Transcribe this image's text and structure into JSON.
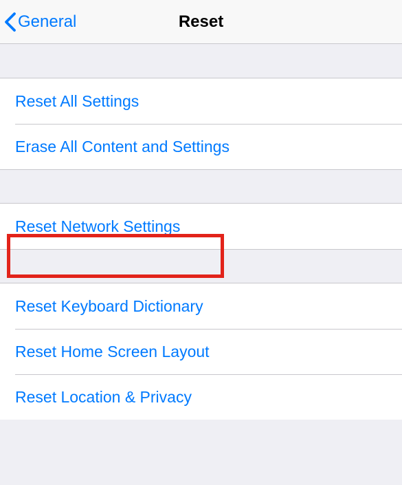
{
  "nav": {
    "back_label": "General",
    "title": "Reset"
  },
  "groups": [
    {
      "items": [
        {
          "label": "Reset All Settings",
          "name": "reset-all-settings"
        },
        {
          "label": "Erase All Content and Settings",
          "name": "erase-all-content-and-settings"
        }
      ]
    },
    {
      "items": [
        {
          "label": "Reset Network Settings",
          "name": "reset-network-settings"
        }
      ]
    },
    {
      "items": [
        {
          "label": "Reset Keyboard Dictionary",
          "name": "reset-keyboard-dictionary"
        },
        {
          "label": "Reset Home Screen Layout",
          "name": "reset-home-screen-layout"
        },
        {
          "label": "Reset Location & Privacy",
          "name": "reset-location-and-privacy"
        }
      ]
    }
  ],
  "highlight": {
    "color": "#e2231a",
    "target": "reset-network-settings"
  }
}
